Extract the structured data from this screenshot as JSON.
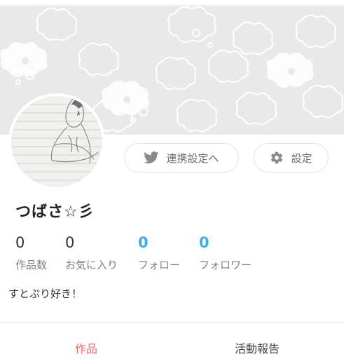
{
  "profile": {
    "username": "つばさ☆彡",
    "bio": "すとぷり好き！"
  },
  "buttons": {
    "twitter_link": "連携設定へ",
    "settings": "設定"
  },
  "stats": [
    {
      "value": "0",
      "label": "作品数"
    },
    {
      "value": "0",
      "label": "お気に入り"
    },
    {
      "value": "0",
      "label": "フォロー"
    },
    {
      "value": "0",
      "label": "フォロワー"
    }
  ],
  "tabs": [
    {
      "label": "作品",
      "active": true
    },
    {
      "label": "活動報告",
      "active": false
    }
  ],
  "colors": {
    "accent_blue": "#3aaee8",
    "active_tab": "#f06a6a",
    "cover_bg": "#e9e9e9"
  },
  "icons": {
    "twitter": "twitter-bird-icon",
    "settings": "gear-icon"
  }
}
